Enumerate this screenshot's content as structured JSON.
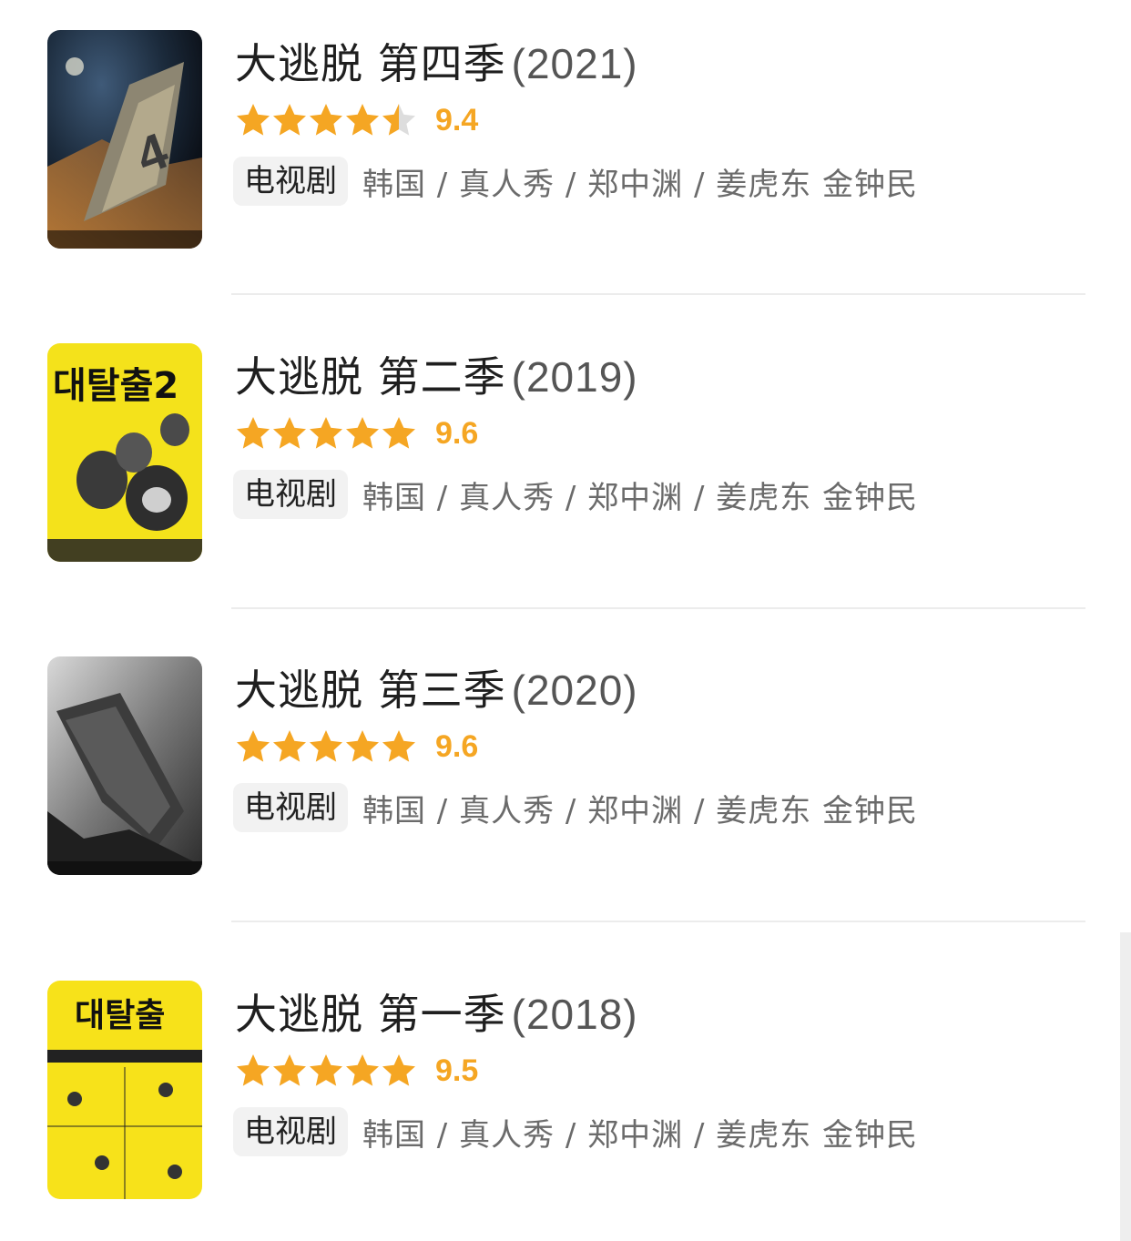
{
  "items": [
    {
      "title": "大逃脱 第四季",
      "year": "(2021)",
      "rating": 9.4,
      "score_label": "9.4",
      "stars_filled": 4.5,
      "tag": "电视剧",
      "meta": "韩国 / 真人秀 / 郑中渊 / 姜虎东 金钟民",
      "poster": "poster-season-4"
    },
    {
      "title": "大逃脱 第二季",
      "year": "(2019)",
      "rating": 9.6,
      "score_label": "9.6",
      "stars_filled": 5,
      "tag": "电视剧",
      "meta": "韩国 / 真人秀 / 郑中渊 / 姜虎东 金钟民",
      "poster": "poster-season-2",
      "poster_text": "대탈출2"
    },
    {
      "title": "大逃脱 第三季",
      "year": "(2020)",
      "rating": 9.6,
      "score_label": "9.6",
      "stars_filled": 5,
      "tag": "电视剧",
      "meta": "韩国 / 真人秀 / 郑中渊 / 姜虎东 金钟民",
      "poster": "poster-season-3"
    },
    {
      "title": "大逃脱 第一季",
      "year": "(2018)",
      "rating": 9.5,
      "score_label": "9.5",
      "stars_filled": 5,
      "tag": "电视剧",
      "meta": "韩国 / 真人秀 / 郑中渊 / 姜虎东 金钟民",
      "poster": "poster-season-1",
      "poster_text": "대탈출"
    }
  ],
  "colors": {
    "star": "#f5a623",
    "star_empty": "#dddddd",
    "score": "#f5a623",
    "tag_bg": "#f2f2f2"
  }
}
